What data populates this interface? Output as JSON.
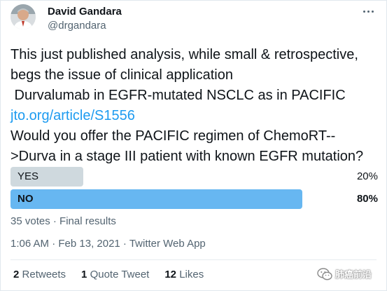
{
  "tweet": {
    "author_name": "David Gandara",
    "author_handle": "@drgandara",
    "text_lines": [
      "This just published analysis, while small & retrospective,",
      "begs the issue of clinical application",
      " Durvalumab in EGFR-mutated NSCLC as in PACIFIC",
      "jto.org/article/S1556",
      "Would you offer the PACIFIC regimen of ChemoRT--",
      ">Durva in a stage III patient with known EGFR mutation?"
    ],
    "link_text": "jto.org/article/S1556",
    "poll": {
      "options": [
        {
          "label": "YES",
          "percent_text": "20%",
          "value": 20,
          "winner": false
        },
        {
          "label": "NO",
          "percent_text": "80%",
          "value": 80,
          "winner": true
        }
      ],
      "summary": "35 votes · Final results"
    },
    "timestamp": "1:06 AM · Feb 13, 2021 · Twitter Web App",
    "stats": {
      "retweets_count": "2",
      "retweets_label": "Retweets",
      "quotes_count": "1",
      "quotes_label": "Quote Tweet",
      "likes_count": "12",
      "likes_label": "Likes"
    },
    "icons": {
      "more": "more-horizontal-icon",
      "watermark": "wechat-icon"
    }
  },
  "watermark": {
    "text": "肺癌前沿"
  },
  "colors": {
    "link": "#1d9bf0",
    "poll_winner": "#67b7f1",
    "poll_other": "#cfd9de",
    "secondary_text": "#536471"
  }
}
